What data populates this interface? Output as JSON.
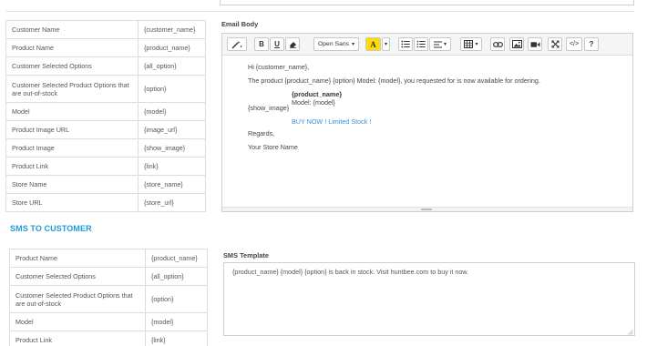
{
  "email_placeholders": [
    {
      "label": "Customer Name",
      "token": "{customer_name}"
    },
    {
      "label": "Product Name",
      "token": "{product_name}"
    },
    {
      "label": "Customer Selected Options",
      "token": "{all_option}"
    },
    {
      "label": "Customer Selected Product Options that are out-of-stock",
      "token": "{option}"
    },
    {
      "label": "Model",
      "token": "{model}"
    },
    {
      "label": "Product Image URL",
      "token": "{image_url}"
    },
    {
      "label": "Product Image",
      "token": "{show_image}"
    },
    {
      "label": "Product Link",
      "token": "{link}"
    },
    {
      "label": "Store Name",
      "token": "{store_name}"
    },
    {
      "label": "Store URL",
      "token": "{store_url}"
    }
  ],
  "email": {
    "label": "Email Body",
    "toolbar": {
      "font_name": "Open Sans",
      "color_letter": "A",
      "bold": "B",
      "underline": "U",
      "codeview": "</>",
      "help": "?"
    },
    "body": {
      "greeting": "Hi {customer_name},",
      "line1": "The product {product_name} {option} Model: {model}, you requested for is now available for ordering.",
      "image_token": "{show_image}",
      "product_name_token": "{product_name}",
      "model_line": "Model: {model}",
      "buy_link": "BUY NOW ! Limited Stock !",
      "regards": "Regards,",
      "signature": "Your Store Name"
    }
  },
  "sms": {
    "heading": "SMS TO CUSTOMER",
    "label": "SMS Template",
    "template": "{product_name} {model} {option} is back in stock. Visit huntbee.com to buy it now.",
    "placeholders": [
      {
        "label": "Product Name",
        "token": "{product_name}"
      },
      {
        "label": "Customer Selected Options",
        "token": "{all_option}"
      },
      {
        "label": "Customer Selected Product Options that are out-of-stock",
        "token": "{option}"
      },
      {
        "label": "Model",
        "token": "{model}"
      },
      {
        "label": "Product Link",
        "token": "{link}"
      }
    ]
  },
  "colors": {
    "accent": "#1f9bd6",
    "link": "#3a8fd6",
    "highlight": "#ffdd00",
    "border": "#dddddd"
  },
  "icons": [
    "magic-wand-icon",
    "eraser-icon",
    "unordered-list-icon",
    "ordered-list-icon",
    "align-icon",
    "table-icon",
    "link-icon",
    "picture-icon",
    "video-icon",
    "fullscreen-icon"
  ]
}
